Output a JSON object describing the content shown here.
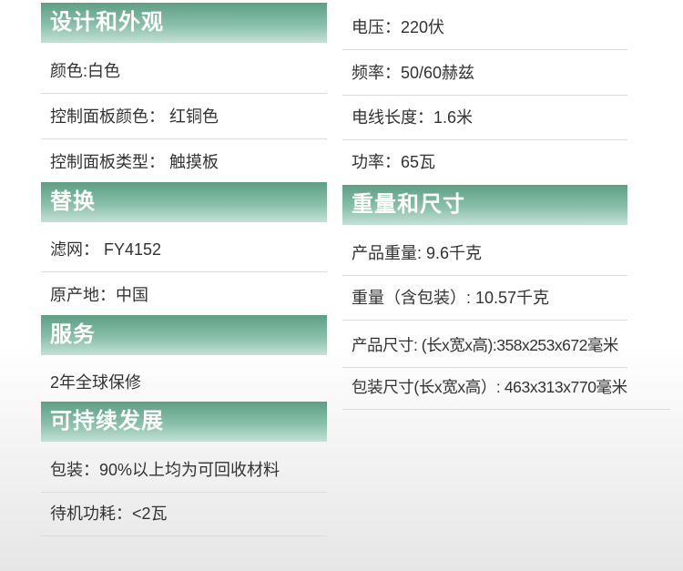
{
  "left": {
    "sections": [
      {
        "title": "设计和外观",
        "rows": [
          {
            "text": "颜色:白色"
          },
          {
            "text": "控制面板颜色： 红铜色"
          },
          {
            "text": "控制面板类型： 触摸板"
          }
        ]
      },
      {
        "title": "替换",
        "rows": [
          {
            "text": "滤网：   FY4152"
          },
          {
            "text": "原产地：中国"
          }
        ]
      },
      {
        "title": "服务",
        "rows": [
          {
            "text": "2年全球保修"
          }
        ]
      },
      {
        "title": "可持续发展",
        "rows": [
          {
            "text": "包装：90%以上均为可回收材料"
          },
          {
            "text": "待机功耗：<2瓦"
          }
        ]
      }
    ]
  },
  "right": {
    "rows_top": [
      {
        "text": "电压：220伏"
      },
      {
        "text": "频率：50/60赫兹"
      },
      {
        "text": "电线长度：1.6米"
      },
      {
        "text": "功率：65瓦"
      }
    ],
    "section": {
      "title": "重量和尺寸",
      "rows": [
        {
          "text": "产品重量: 9.6千克"
        },
        {
          "text": "重量（含包装）: 10.57千克"
        },
        {
          "text": "产品尺寸: (长x宽x高):358x253x672毫米"
        },
        {
          "text": "包装尺寸(长x宽x高）: 463x313x770毫米"
        }
      ]
    }
  },
  "colors": {
    "header_gradient_top": "#5d9f84",
    "header_gradient_bottom": "#c4e1d6",
    "header_text": "#ffffff",
    "row_text": "#333333",
    "divider": "#dcdcdc"
  }
}
